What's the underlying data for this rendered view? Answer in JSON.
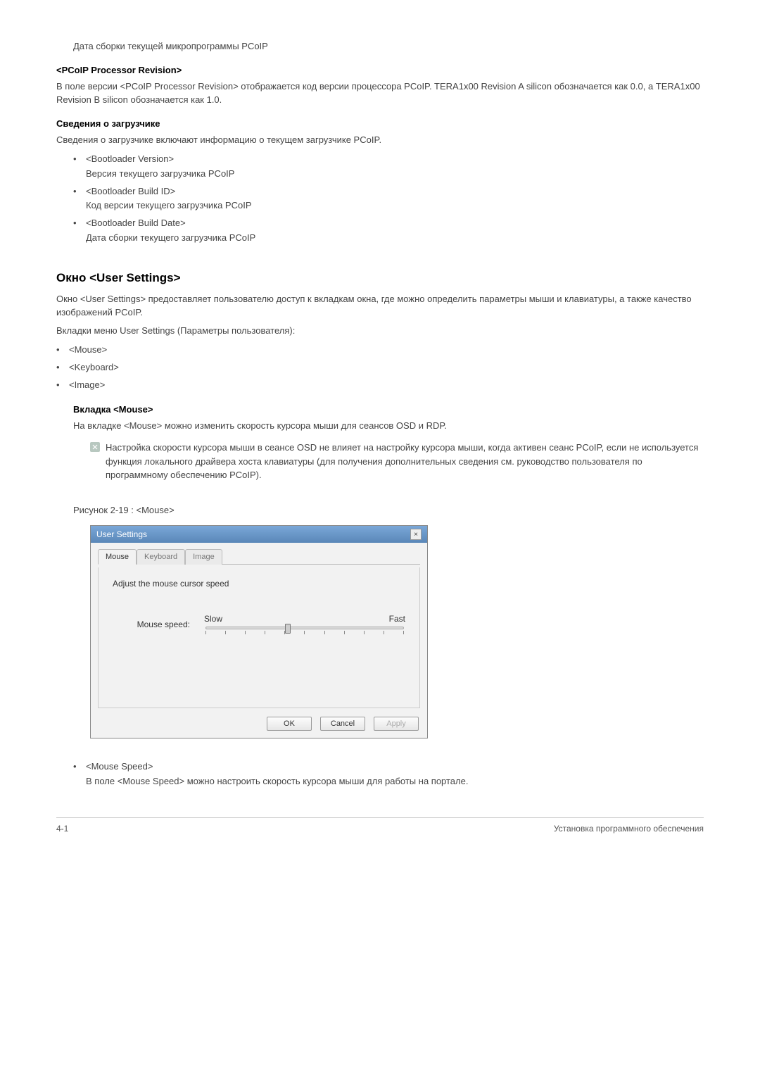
{
  "intro_line": "Дата сборки текущей микропрограммы PCoIP",
  "processor_heading": "<PCoIP Processor Revision>",
  "processor_text": "В поле версии <PCoIP Processor Revision> отображается код версии процессора PCoIP. TERA1x00 Revision A silicon обозначается как 0.0, а TERA1x00 Revision B silicon обозначается как 1.0.",
  "bootloader_heading": "Сведения о загрузчике",
  "bootloader_intro": "Сведения о загрузчике включают информацию о текущем загрузчике PCoIP.",
  "bootloader_items": [
    {
      "label": "<Bootloader Version>",
      "desc": "Версия текущего загрузчика PCoIP"
    },
    {
      "label": "<Bootloader Build ID>",
      "desc": "Код версии текущего загрузчика PCoIP"
    },
    {
      "label": "<Bootloader Build Date>",
      "desc": "Дата сборки текущего загрузчика PCoIP"
    }
  ],
  "user_settings_heading": "Окно <User Settings>",
  "user_settings_para": "Окно <User Settings> предоставляет пользователю доступ к вкладкам окна, где можно определить параметры мыши и клавиатуры, а также качество изображений PCoIP.",
  "user_settings_tabs_intro": "Вкладки меню User Settings (Параметры пользователя):",
  "user_settings_tabs": [
    "<Mouse>",
    "<Keyboard>",
    "<Image>"
  ],
  "mouse_tab_heading": "Вкладка <Mouse>",
  "mouse_tab_para": "На вкладке <Mouse> можно изменить скорость курсора мыши для сеансов OSD и RDP.",
  "mouse_note": "Настройка скорости курсора мыши в сеансе OSD не влияет на настройку курсора мыши, когда активен сеанс PCoIP, если не используется функция локального драйвера хоста клавиатуры (для получения дополнительных сведения см. руководство пользователя по программному обеспечению PCoIP).",
  "figure_caption": "Рисунок 2-19 : <Mouse>",
  "dialog": {
    "title": "User Settings",
    "close": "×",
    "tabs": {
      "mouse": "Mouse",
      "keyboard": "Keyboard",
      "image": "Image"
    },
    "panel_heading": "Adjust the mouse cursor speed",
    "slider_label": "Mouse speed:",
    "slow": "Slow",
    "fast": "Fast",
    "ok": "OK",
    "cancel": "Cancel",
    "apply": "Apply"
  },
  "mouse_speed_label": "<Mouse Speed>",
  "mouse_speed_desc": "В поле <Mouse Speed> можно настроить скорость курсора мыши для работы на портале.",
  "footer": {
    "left": "4-1",
    "right": "Установка программного обеспечения"
  }
}
